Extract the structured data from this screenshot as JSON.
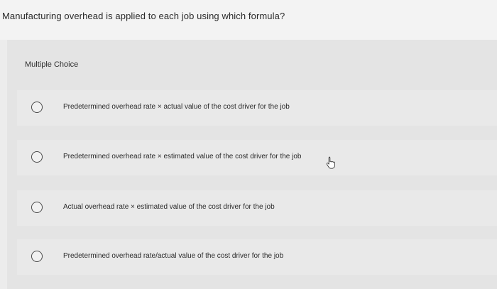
{
  "question": {
    "text": "Manufacturing overhead is applied to each job using which formula?"
  },
  "answer_block": {
    "heading": "Multiple Choice",
    "options": [
      {
        "label": "Predetermined overhead rate × actual value of the cost driver for the job",
        "selected": false
      },
      {
        "label": "Predetermined overhead rate × estimated value of the cost driver for the job",
        "selected": false
      },
      {
        "label": "Actual overhead rate × estimated value of the cost driver for the job",
        "selected": false
      },
      {
        "label": "Predetermined overhead rate/actual value of the cost driver for the job",
        "selected": false
      }
    ]
  },
  "icons": {
    "radio": "radio-unchecked-icon",
    "cursor": "hand-pointer-icon"
  }
}
